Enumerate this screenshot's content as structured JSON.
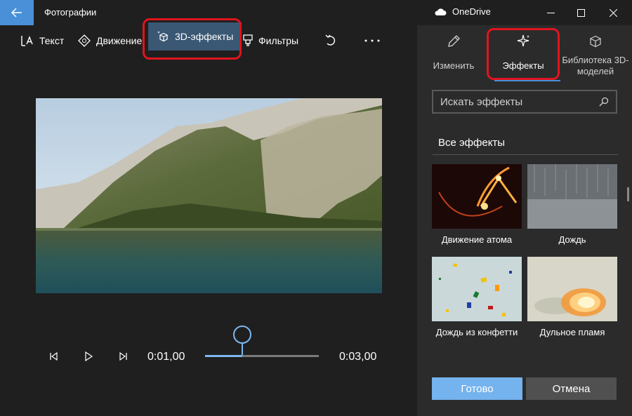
{
  "window": {
    "app_title": "Фотографии",
    "onedrive_label": "OneDrive"
  },
  "toolbar": {
    "text_label": "Текст",
    "motion_label": "Движение",
    "effects3d_label": "3D-эффекты",
    "filters_label": "Фильтры"
  },
  "player": {
    "current_time": "0:01,00",
    "total_time": "0:03,00",
    "progress_percent": 33
  },
  "panel": {
    "tabs": [
      {
        "label": "Изменить",
        "icon": "pencil-icon"
      },
      {
        "label": "Эффекты",
        "icon": "sparkle-icon",
        "selected": true
      },
      {
        "label": "Библиотека 3D-моделей",
        "icon": "cube-icon"
      }
    ],
    "search_placeholder": "Искать эффекты",
    "section_title": "Все эффекты",
    "effects": [
      {
        "label": "Движение атома"
      },
      {
        "label": "Дождь"
      },
      {
        "label": "Дождь из конфетти"
      },
      {
        "label": "Дульное пламя"
      }
    ],
    "done_label": "Готово",
    "cancel_label": "Отмена"
  },
  "colors": {
    "accent": "#4a90d9",
    "active_tab_bg": "#3a5874",
    "highlight_red": "#e0141e",
    "primary_button": "#74b3ee"
  }
}
